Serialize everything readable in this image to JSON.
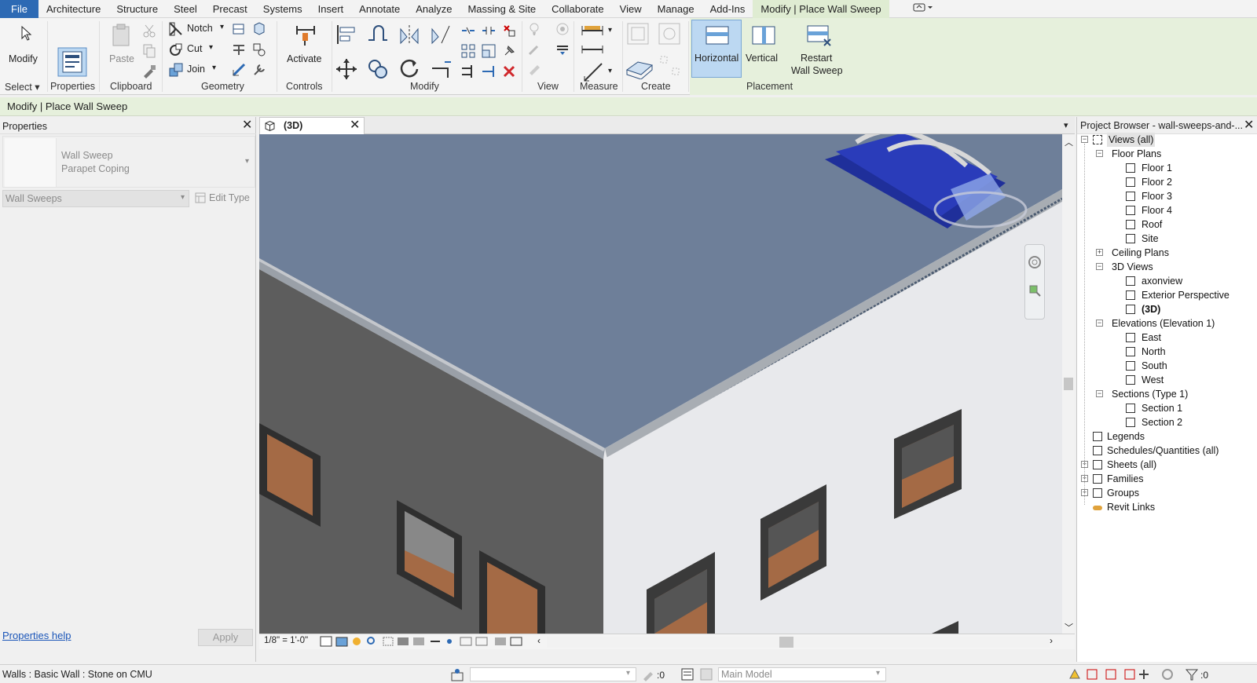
{
  "menu": {
    "tabs": [
      "File",
      "Architecture",
      "Structure",
      "Steel",
      "Precast",
      "Systems",
      "Insert",
      "Annotate",
      "Analyze",
      "Massing & Site",
      "Collaborate",
      "View",
      "Manage",
      "Add-Ins",
      "Modify | Place Wall Sweep"
    ]
  },
  "ribbon": {
    "modify_label": "Modify",
    "paste_label": "Paste",
    "notch_label": "Notch",
    "cut_label": "Cut",
    "join_label": "Join",
    "activate_label": "Activate",
    "horizontal_label": "Horizontal",
    "vertical_label": "Vertical",
    "restart_line1": "Restart",
    "restart_line2": "Wall Sweep",
    "panels": {
      "select": "Select",
      "properties": "Properties",
      "clipboard": "Clipboard",
      "geometry": "Geometry",
      "controls": "Controls",
      "modify": "Modify",
      "view": "View",
      "measure": "Measure",
      "create": "Create",
      "placement": "Placement"
    }
  },
  "options_bar": {
    "text": "Modify | Place Wall Sweep"
  },
  "properties": {
    "title": "Properties",
    "type_name": "Wall Sweep",
    "type_sub": "Parapet Coping",
    "filter": "Wall Sweeps",
    "edit_type": "Edit Type",
    "help": "Properties help",
    "apply": "Apply"
  },
  "view": {
    "tab": "(3D)",
    "scale": "1/8\" = 1'-0\""
  },
  "project_browser": {
    "title": "Project Browser - wall-sweeps-and-...",
    "views_all": "Views (all)",
    "floor_plans": "Floor Plans",
    "floor_plan_items": [
      "Floor 1",
      "Floor 2",
      "Floor 3",
      "Floor 4",
      "Roof",
      "Site"
    ],
    "ceiling_plans": "Ceiling Plans",
    "views_3d": "3D Views",
    "views_3d_items": [
      "axonview",
      "Exterior Perspective",
      "(3D)"
    ],
    "elevations": "Elevations (Elevation 1)",
    "elevation_items": [
      "East",
      "North",
      "South",
      "West"
    ],
    "sections": "Sections (Type 1)",
    "section_items": [
      "Section 1",
      "Section 2"
    ],
    "legends": "Legends",
    "schedules": "Schedules/Quantities (all)",
    "sheets": "Sheets (all)",
    "families": "Families",
    "groups": "Groups",
    "revit_links": "Revit Links"
  },
  "status": {
    "left": "Walls : Basic Wall : Stone on CMU",
    "zero": ":0",
    "model": "Main Model",
    "filter_zero": ":0"
  },
  "colors": {
    "file_tab": "#2d6ab4",
    "context_band": "#e6f0dc",
    "active_button": "#bcd8f2",
    "roof": "#6e7f99",
    "dark_wall": "#5d5d5d",
    "light_wall": "#e8e9ec",
    "window_glass": "#a46a45"
  }
}
